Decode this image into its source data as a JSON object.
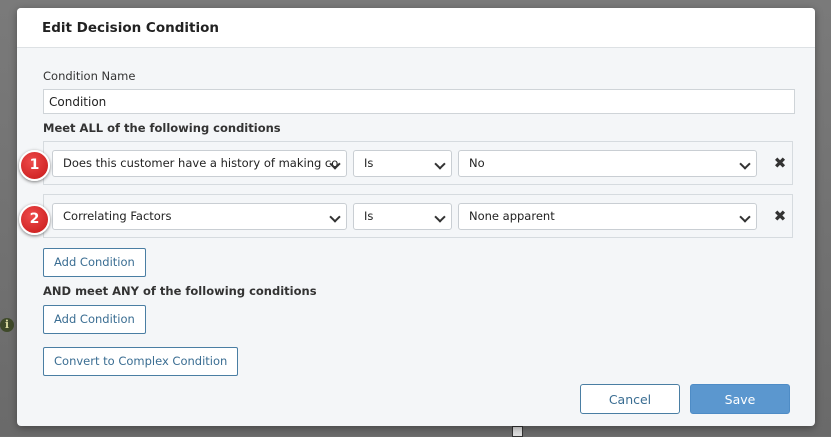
{
  "dialog": {
    "title": "Edit Decision Condition",
    "condition_name_label": "Condition Name",
    "condition_name_value": "Condition",
    "all_section_label": "Meet ALL of the following conditions",
    "all_conditions": [
      {
        "badge": "1",
        "field": "Does this customer have a history of making co",
        "operator": "Is",
        "value": "No"
      },
      {
        "badge": "2",
        "field": "Correlating Factors",
        "operator": "Is",
        "value": "None apparent"
      }
    ],
    "add_condition_label": "Add Condition",
    "any_section_label": "AND meet ANY of the following conditions",
    "any_add_condition_label": "Add Condition",
    "convert_label": "Convert to Complex Condition",
    "cancel_label": "Cancel",
    "save_label": "Save"
  },
  "colors": {
    "accent": "#5b97cf",
    "badge": "#d42020",
    "outline": "#4a7ea3"
  },
  "icons": {
    "remove": "close-icon",
    "dropdown": "chevron-down-icon",
    "background_info": "info-icon"
  }
}
